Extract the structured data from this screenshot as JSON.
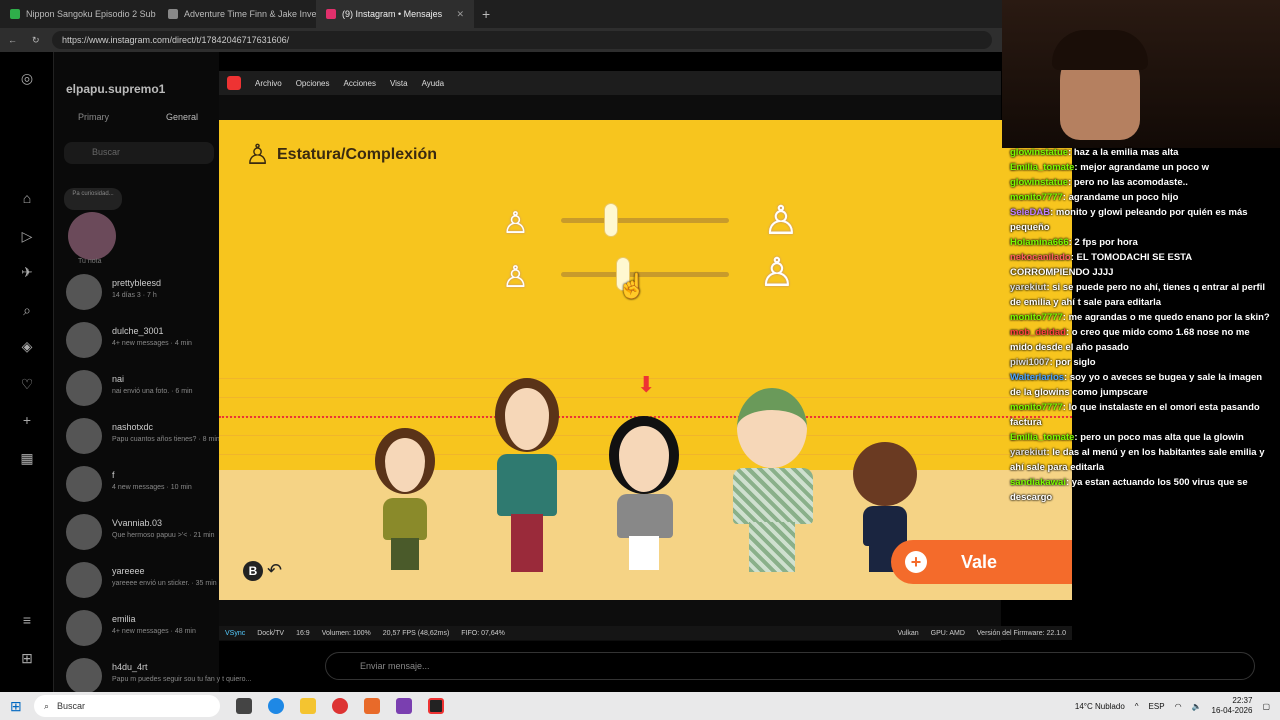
{
  "browser": {
    "tabs": [
      {
        "title": "Nippon Sangoku Episodio 2 Sub E",
        "color": "#2fae4a"
      },
      {
        "title": "Adventure Time Finn & Jake Inve",
        "color": "#888888"
      },
      {
        "title": "(9) Instagram • Mensajes",
        "color": "#e1306c",
        "active": true
      }
    ],
    "url": "https://www.instagram.com/direct/t/17842046717631606/"
  },
  "instagram": {
    "account": "elpapu.supremo1",
    "tabs": [
      "Primary",
      "General"
    ],
    "search_placeholder": "Buscar",
    "note_label": "Tu nota",
    "note_bubble": "Pa curiosidad...",
    "conversations": [
      {
        "name": "prettybleesd",
        "sub": "14 días 3 · 7 h"
      },
      {
        "name": "dulche_3001",
        "sub": "4+ new messages · 4 min"
      },
      {
        "name": "nai",
        "sub": "nai envió una foto. · 6 min"
      },
      {
        "name": "nashotxdc",
        "sub": "Papu cuantos años tienes? · 8 min"
      },
      {
        "name": "f",
        "sub": "4 new messages · 10 min"
      },
      {
        "name": "Vvanniab.03",
        "sub": "Que hermoso papuu >'< · 21 min"
      },
      {
        "name": "yareeee",
        "sub": "yareeee envió un sticker. · 35 min"
      },
      {
        "name": "emilia",
        "sub": "4+ new messages · 48 min"
      },
      {
        "name": "h4du_4rt",
        "sub": "Papu m puedes seguir sou tu fan y t quiero..."
      }
    ],
    "compose_placeholder": "Enviar mensaje..."
  },
  "emulator": {
    "menu": [
      "Archivo",
      "Opciones",
      "Acciones",
      "Vista",
      "Ayuda"
    ],
    "status_left": [
      "VSync",
      "Dock/TV",
      "16:9",
      "Volumen: 100%",
      "20,57 FPS (48,62ms)",
      "FIFO: 07,64%"
    ],
    "status_right": [
      "Vulkan",
      "GPU: AMD",
      "Versión del Firmware: 22.1.0"
    ]
  },
  "game": {
    "title": "Estatura/Complexión",
    "height_slider": 0.3,
    "build_slider": 0.37,
    "confirm_label": "Vale",
    "back_label": "B",
    "colors": {
      "background": "#f7c51e",
      "confirm": "#f46b2b"
    }
  },
  "chat": [
    {
      "user": "glowinstatue",
      "color": "#7CFC00",
      "msg": ": haz a la emilia mas alta"
    },
    {
      "user": "Emilia_tomate",
      "color": "#7CFC00",
      "msg": ": mejor agrandame un poco w"
    },
    {
      "user": "glowinstatue",
      "color": "#7CFC00",
      "msg": ": pero no las acomodaste.."
    },
    {
      "user": "monito7777",
      "color": "#7CFC00",
      "msg": ": agrandame un poco hijo"
    },
    {
      "user": "SeleDAB",
      "color": "#c080ff",
      "msg": ": monito y glowi peleando por quién es más pequeño"
    },
    {
      "user": "Holamina666",
      "color": "#7CFC00",
      "msg": ": 2 fps por hora"
    },
    {
      "user": "nekocanilado",
      "color": "#ff6060",
      "msg": ": EL TOMODACHI SE ESTA CORROMPIENDO JJJJ"
    },
    {
      "user": "yarekiut",
      "color": "#dddddd",
      "msg": ": si se puede pero no ahí, tienes q entrar al perfil de emilia y ahí t sale para editarla"
    },
    {
      "user": "monito7777",
      "color": "#7CFC00",
      "msg": ": me agrandas o me quedo enano por la skin?"
    },
    {
      "user": "mob_deidad",
      "color": "#ff4040",
      "msg": ": o creo que mido como 1.68 nose no me mido desde el año pasado"
    },
    {
      "user": "piwi1007",
      "color": "#dddddd",
      "msg": ": por siglo"
    },
    {
      "user": "Walterlarios",
      "color": "#4da6ff",
      "msg": ": soy yo o aveces se bugea y sale la imagen de la glowins como jumpscare"
    },
    {
      "user": "monito7777",
      "color": "#7CFC00",
      "msg": ": lo que instalaste en el omori esta pasando factura"
    },
    {
      "user": "Emilia_tomate",
      "color": "#7CFC00",
      "msg": ": pero un poco mas alta que la glowin"
    },
    {
      "user": "yarekiut",
      "color": "#dddddd",
      "msg": ": le das al menú y en los habitantes sale emilia y ahí sale para editarla"
    },
    {
      "user": "sandiakawai",
      "color": "#7CFC00",
      "msg": ": ya estan actuando los 500 virus que se descargo"
    }
  ],
  "taskbar": {
    "search": "Buscar",
    "weather": "14°C  Nublado",
    "lang": "ESP",
    "time": "22:37",
    "date": "16-04-2026"
  }
}
